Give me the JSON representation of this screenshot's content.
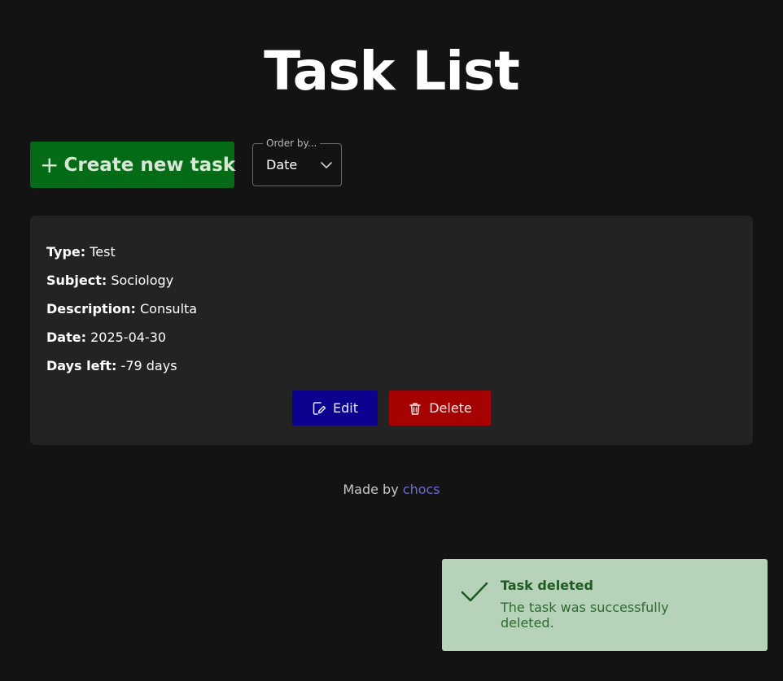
{
  "page": {
    "title": "Task List"
  },
  "toolbar": {
    "create_label": "Create new task",
    "create_icon": "plus-icon",
    "order_label": "Order by...",
    "order_value": "Date",
    "order_icon": "chevron-down-icon"
  },
  "task": {
    "type_label": "Type:",
    "type_value": "Test",
    "subject_label": "Subject:",
    "subject_value": "Sociology",
    "description_label": "Description:",
    "description_value": "Consulta",
    "date_label": "Date:",
    "date_value": "2025-04-30",
    "days_left_label": "Days left:",
    "days_left_value": "-79 days",
    "edit_label": "Edit",
    "edit_icon": "edit-icon",
    "delete_label": "Delete",
    "delete_icon": "trash-icon"
  },
  "footer": {
    "made_by": "Made by",
    "author": "chocs"
  },
  "toast": {
    "title": "Task deleted",
    "message": "The task was successfully deleted.",
    "icon": "check-icon"
  },
  "colors": {
    "background": "#131313",
    "card": "#232323",
    "create_button": "#066b16",
    "edit_button": "#0c0290",
    "delete_button": "#a50303",
    "link": "#6b6bdb",
    "toast_bg": "#b6d2b8",
    "toast_text": "#1f5a22"
  }
}
